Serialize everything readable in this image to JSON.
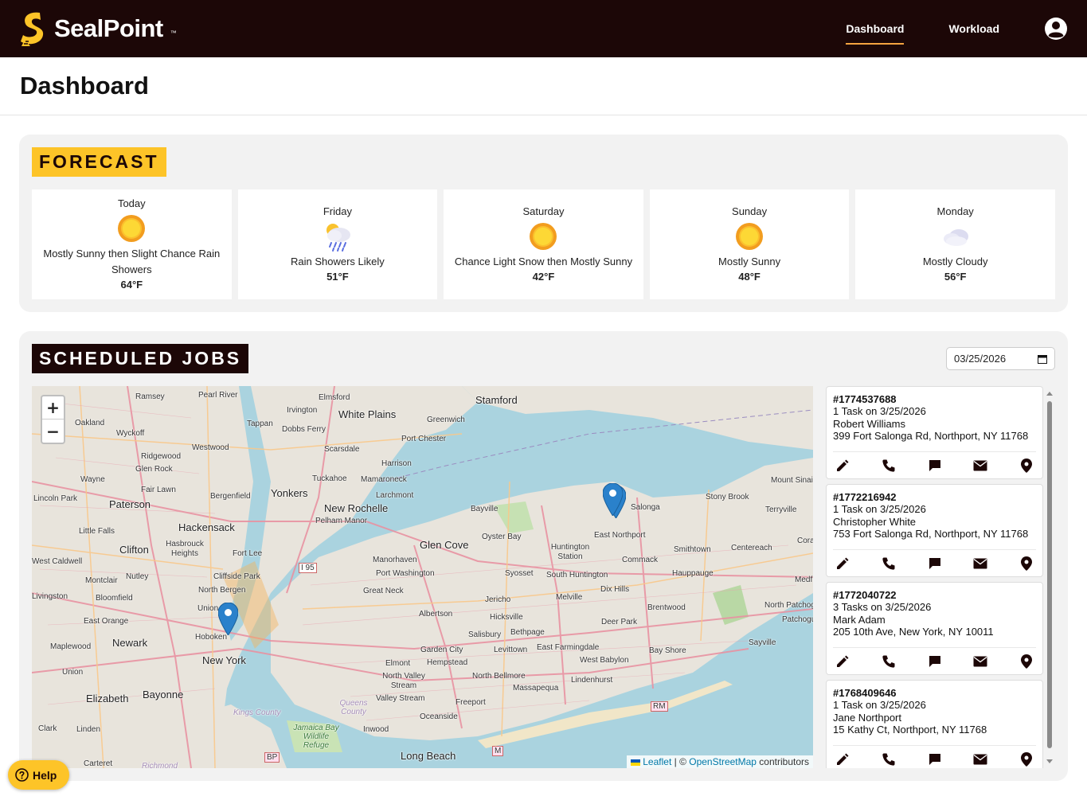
{
  "brand": {
    "name": "SealPoint",
    "tm": "™",
    "accent": "#fdc428",
    "dark": "#1c0707"
  },
  "nav": {
    "dashboard": "Dashboard",
    "workload": "Workload",
    "user_icon": "user-circle-icon"
  },
  "page": {
    "title": "Dashboard"
  },
  "forecast": {
    "title": "FORECAST",
    "days": [
      {
        "name": "Today",
        "icon": "sun-icon",
        "desc": "Mostly Sunny then Slight Chance Rain Showers",
        "temp": "64°F"
      },
      {
        "name": "Friday",
        "icon": "rain-cloud-icon",
        "desc": "Rain Showers Likely",
        "temp": "51°F"
      },
      {
        "name": "Saturday",
        "icon": "sun-icon",
        "desc": "Chance Light Snow then Mostly Sunny",
        "temp": "42°F"
      },
      {
        "name": "Sunday",
        "icon": "sun-icon",
        "desc": "Mostly Sunny",
        "temp": "48°F"
      },
      {
        "name": "Monday",
        "icon": "cloud-icon",
        "desc": "Mostly Cloudy",
        "temp": "56°F"
      }
    ]
  },
  "jobs": {
    "title": "SCHEDULED JOBS",
    "date": "03/25/2026",
    "items": [
      {
        "id": "#1774537688",
        "tasks": "1 Task on 3/25/2026",
        "customer": "Robert Williams",
        "address": "399 Fort Salonga Rd, Northport, NY 11768"
      },
      {
        "id": "#1772216942",
        "tasks": "1 Task on 3/25/2026",
        "customer": "Christopher White",
        "address": "753 Fort Salonga Rd, Northport, NY 11768"
      },
      {
        "id": "#1772040722",
        "tasks": "3 Tasks on 3/25/2026",
        "customer": "Mark Adam",
        "address": "205 10th Ave, New York, NY 10011"
      },
      {
        "id": "#1768409646",
        "tasks": "1 Task on 3/25/2026",
        "customer": "Jane Northport",
        "address": "15 Kathy Ct, Northport, NY 11768"
      }
    ]
  },
  "map": {
    "zoom_in": "+",
    "zoom_out": "−",
    "attribution": {
      "leaflet": "Leaflet",
      "sep": " | © ",
      "osm": "OpenStreetMap",
      "contributors": " contributors"
    },
    "places": {
      "p1": "Ramsey",
      "p2": "Pearl River",
      "p3": "Elmsford",
      "p4": "Stamford",
      "p5": "Oakland",
      "p6": "Wyckoff",
      "p7": "Irvington",
      "p8": "White Plains",
      "p9": "Greenwich",
      "p10": "Tappan",
      "p11": "Dobbs Ferry",
      "p12": "Port Chester",
      "p13": "Ridgewood",
      "p14": "Glen Rock",
      "p15": "Westwood",
      "p16": "Scarsdale",
      "p17": "Harrison",
      "p18": "Wayne",
      "p19": "Fair Lawn",
      "p20": "Tuckahoe",
      "p21": "Mamaroneck",
      "p22": "Lincoln Park",
      "p23": "Paterson",
      "p24": "Bergenfield",
      "p25": "Yonkers",
      "p26": "Larchmont",
      "p27": "New Rochelle",
      "p28": "Pelham Manor",
      "p29": "Bayville",
      "p30": "Salonga",
      "p31": "Stony Brook",
      "p32": "Mount Sinai",
      "p33": "Terryville",
      "p34": "Little Falls",
      "p35": "Hackensack",
      "p36": "Oyster Bay",
      "p37": "East Northport",
      "p38": "Clifton",
      "p39": "Hasbrouck Heights",
      "p40": "Fort Lee",
      "p41": "Glen Cove",
      "p42": "Huntington Station",
      "p43": "Smithtown",
      "p44": "Centereach",
      "p45": "West Caldwell",
      "p46": "Manorhaven",
      "p47": "Commack",
      "p48": "Cliffside Park",
      "p49": "Nutley",
      "p50": "Port Washington",
      "p51": "Syosset",
      "p52": "South Huntington",
      "p53": "Hauppauge",
      "p54": "Montclair",
      "p55": "North Bergen",
      "p56": "Great Neck",
      "p57": "Dix Hills",
      "p58": "Livingston",
      "p59": "Bloomfield",
      "p60": "Jericho",
      "p61": "Melville",
      "p62": "Union City",
      "p63": "Albertson",
      "p64": "Hicksville",
      "p65": "Brentwood",
      "p66": "North Patchogue",
      "p67": "East Orange",
      "p68": "Deer Park",
      "p69": "Patchogue",
      "p70": "Newark",
      "p71": "Hoboken",
      "p72": "Salisbury",
      "p73": "Bethpage",
      "p74": "Sayville",
      "p75": "Maplewood",
      "p76": "Garden City",
      "p77": "Levittown",
      "p78": "East Farmingdale",
      "p79": "Bay Shore",
      "p80": "New York",
      "p81": "Hempstead",
      "p82": "West Babylon",
      "p83": "Union",
      "p84": "Elmont",
      "p85": "North Valley Stream",
      "p86": "North Bellmore",
      "p87": "Lindenhurst",
      "p88": "Massapequa",
      "p89": "Elizabeth",
      "p90": "Bayonne",
      "p91": "Valley Stream",
      "p92": "Freeport",
      "p93": "Kings County",
      "p94": "Queens County",
      "p95": "Oceanside",
      "p96": "Clark",
      "p97": "Linden",
      "p98": "Jamaica Bay Wildlife Refuge",
      "p99": "Inwood",
      "p100": "Long Beach",
      "p101": "Carteret",
      "p102": "Richmond",
      "p103": "I 95",
      "p104": "RM",
      "p105": "M",
      "p106": "BP",
      "p107": "Cora",
      "p108": "Medf"
    }
  },
  "help": {
    "label": "Help",
    "icon": "question-circle-icon"
  }
}
